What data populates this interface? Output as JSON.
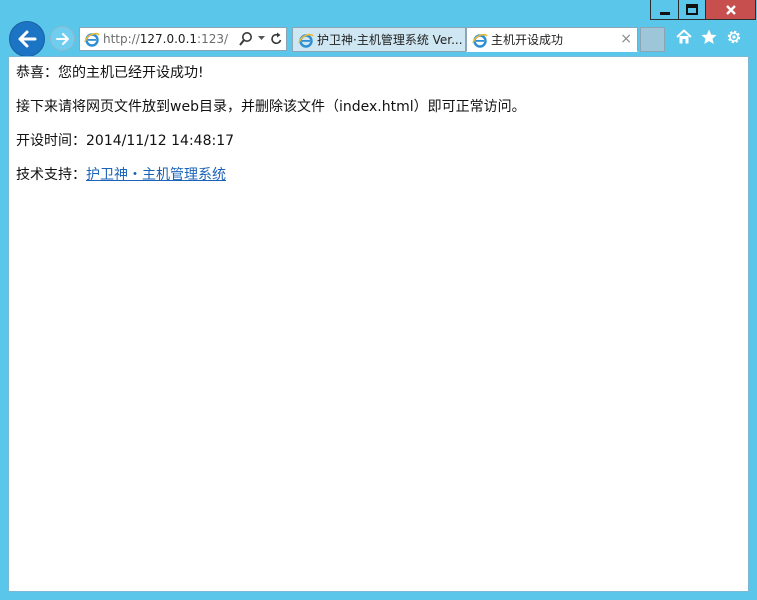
{
  "window": {
    "minimize_icon": "minimize-icon",
    "maximize_icon": "maximize-icon",
    "close_icon": "close-icon"
  },
  "address_bar": {
    "scheme": "http://",
    "host": "127.0.0.1",
    "rest": ":123/",
    "search_icon": "search-icon",
    "refresh_icon": "refresh-icon"
  },
  "tabs": [
    {
      "label": "护卫神·主机管理系统 Ver...",
      "active": false
    },
    {
      "label": "主机开设成功",
      "active": true,
      "close": "×"
    }
  ],
  "toolbar_icons": [
    "home-icon",
    "favorites-star-icon",
    "settings-gear-icon"
  ],
  "content": {
    "line1": "恭喜：您的主机已经开设成功!",
    "line2": "接下来请将网页文件放到web目录，并删除该文件（index.html）即可正常访问。",
    "line3_label": "开设时间：",
    "line3_value": "2014/11/12 14:48:17",
    "line4_label": "技术支持：",
    "line4_link": "护卫神・主机管理系统"
  },
  "colors": {
    "frame": "#5ac6ea",
    "back_button": "#1b74c4",
    "close_button": "#c7504f",
    "link": "#1b63b8"
  }
}
